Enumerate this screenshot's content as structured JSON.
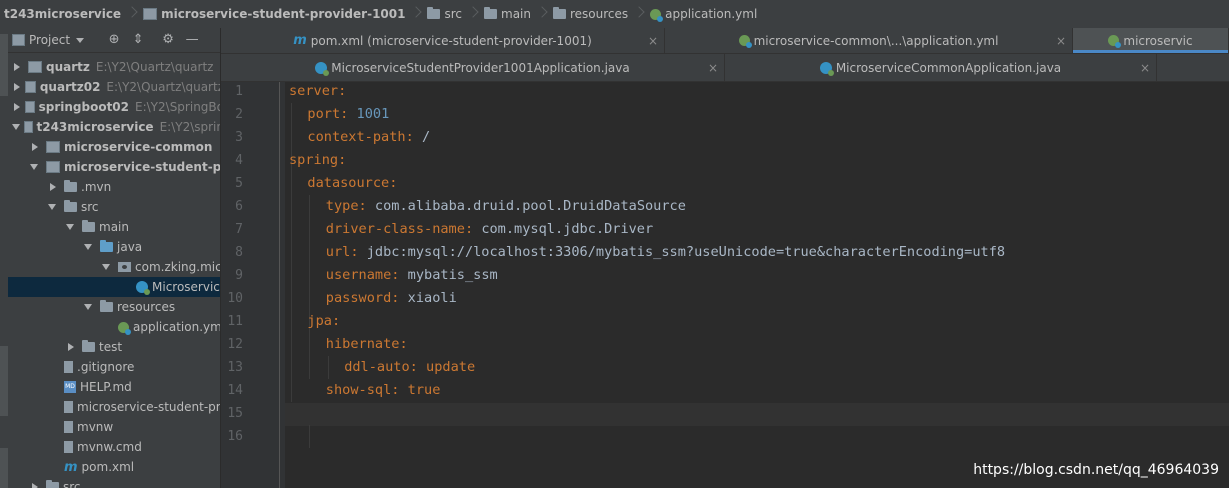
{
  "breadcrumb": [
    "t243microservice",
    "microservice-student-provider-1001",
    "src",
    "main",
    "resources",
    "application.yml"
  ],
  "project_panel": {
    "title": "Project"
  },
  "tree": [
    {
      "label": "quartz",
      "path": "E:\\Y2\\Quartz\\quartz",
      "indent": 0,
      "arrow": "right",
      "icon": "module",
      "bold": true
    },
    {
      "label": "quartz02",
      "path": "E:\\Y2\\Quartz\\quartz",
      "indent": 0,
      "arrow": "right",
      "icon": "module",
      "bold": true
    },
    {
      "label": "springboot02",
      "path": "E:\\Y2\\SpringBo",
      "indent": 0,
      "arrow": "right",
      "icon": "module",
      "bold": true
    },
    {
      "label": "t243microservice",
      "path": "E:\\Y2\\sprin",
      "indent": 0,
      "arrow": "down",
      "icon": "module",
      "bold": true
    },
    {
      "label": "microservice-common",
      "path": "",
      "indent": 1,
      "arrow": "right",
      "icon": "module",
      "bold": true
    },
    {
      "label": "microservice-student-pro",
      "path": "",
      "indent": 1,
      "arrow": "down",
      "icon": "module",
      "bold": true
    },
    {
      "label": ".mvn",
      "path": "",
      "indent": 2,
      "arrow": "right",
      "icon": "folder",
      "bold": false
    },
    {
      "label": "src",
      "path": "",
      "indent": 2,
      "arrow": "down",
      "icon": "folder",
      "bold": false
    },
    {
      "label": "main",
      "path": "",
      "indent": 3,
      "arrow": "down",
      "icon": "folder",
      "bold": false
    },
    {
      "label": "java",
      "path": "",
      "indent": 4,
      "arrow": "down",
      "icon": "folder-blue",
      "bold": false
    },
    {
      "label": "com.zking.mic",
      "path": "",
      "indent": 5,
      "arrow": "down",
      "icon": "package",
      "bold": false
    },
    {
      "label": "Microservic",
      "path": "",
      "indent": 6,
      "arrow": "none",
      "icon": "class",
      "bold": false,
      "selected": true
    },
    {
      "label": "resources",
      "path": "",
      "indent": 4,
      "arrow": "down",
      "icon": "folder",
      "bold": false
    },
    {
      "label": "application.ym",
      "path": "",
      "indent": 5,
      "arrow": "none",
      "icon": "spring",
      "bold": false
    },
    {
      "label": "test",
      "path": "",
      "indent": 3,
      "arrow": "right",
      "icon": "folder",
      "bold": false
    },
    {
      "label": ".gitignore",
      "path": "",
      "indent": 2,
      "arrow": "none",
      "icon": "file",
      "bold": false
    },
    {
      "label": "HELP.md",
      "path": "",
      "indent": 2,
      "arrow": "none",
      "icon": "md",
      "bold": false
    },
    {
      "label": "microservice-student-pr",
      "path": "",
      "indent": 2,
      "arrow": "none",
      "icon": "file",
      "bold": false
    },
    {
      "label": "mvnw",
      "path": "",
      "indent": 2,
      "arrow": "none",
      "icon": "file",
      "bold": false
    },
    {
      "label": "mvnw.cmd",
      "path": "",
      "indent": 2,
      "arrow": "none",
      "icon": "file",
      "bold": false
    },
    {
      "label": "pom.xml",
      "path": "",
      "indent": 2,
      "arrow": "none",
      "icon": "m",
      "bold": false
    },
    {
      "label": "src",
      "path": "",
      "indent": 1,
      "arrow": "right",
      "icon": "folder",
      "bold": false
    }
  ],
  "tabs_row1": [
    {
      "label": "pom.xml (microservice-student-provider-1001)",
      "icon": "m",
      "close": "×"
    },
    {
      "label": "microservice-common\\...\\application.yml",
      "icon": "spring",
      "close": "×"
    },
    {
      "label": "microservic",
      "icon": "spring",
      "close": "",
      "active": true
    }
  ],
  "tabs_row2": [
    {
      "label": "MicroserviceStudentProvider1001Application.java",
      "icon": "class",
      "close": "×"
    },
    {
      "label": "MicroserviceCommonApplication.java",
      "icon": "class",
      "close": "×"
    }
  ],
  "code": [
    {
      "n": "1",
      "indent": 0,
      "key": "server",
      "sep": ":",
      "val": "",
      "vtype": ""
    },
    {
      "n": "2",
      "indent": 1,
      "key": "port",
      "sep": ": ",
      "val": "1001",
      "vtype": "num"
    },
    {
      "n": "3",
      "indent": 1,
      "key": "context-path",
      "sep": ": ",
      "val": "/",
      "vtype": "str"
    },
    {
      "n": "4",
      "indent": 0,
      "key": "spring",
      "sep": ":",
      "val": "",
      "vtype": ""
    },
    {
      "n": "5",
      "indent": 1,
      "key": "datasource",
      "sep": ":",
      "val": "",
      "vtype": ""
    },
    {
      "n": "6",
      "indent": 2,
      "key": "type",
      "sep": ": ",
      "val": "com.alibaba.druid.pool.DruidDataSource",
      "vtype": "str"
    },
    {
      "n": "7",
      "indent": 2,
      "key": "driver-class-name",
      "sep": ": ",
      "val": "com.mysql.jdbc.Driver",
      "vtype": "str"
    },
    {
      "n": "8",
      "indent": 2,
      "key": "url",
      "sep": ": ",
      "val": "jdbc:mysql://localhost:3306/mybatis_ssm?useUnicode=true&characterEncoding=utf8",
      "vtype": "str"
    },
    {
      "n": "9",
      "indent": 2,
      "key": "username",
      "sep": ": ",
      "val": "mybatis_ssm",
      "vtype": "str"
    },
    {
      "n": "10",
      "indent": 2,
      "key": "password",
      "sep": ": ",
      "val": "xiaoli",
      "vtype": "str"
    },
    {
      "n": "11",
      "indent": 1,
      "key": "jpa",
      "sep": ":",
      "val": "",
      "vtype": ""
    },
    {
      "n": "12",
      "indent": 2,
      "key": "hibernate",
      "sep": ":",
      "val": "",
      "vtype": ""
    },
    {
      "n": "13",
      "indent": 3,
      "key": "ddl-auto",
      "sep": ": ",
      "val": "update",
      "vtype": "kw"
    },
    {
      "n": "14",
      "indent": 2,
      "key": "show-sql",
      "sep": ": ",
      "val": "true",
      "vtype": "kw"
    },
    {
      "n": "15",
      "indent": 0,
      "key": "",
      "sep": "",
      "val": "",
      "vtype": ""
    },
    {
      "n": "16",
      "indent": 0,
      "key": "",
      "sep": "",
      "val": "",
      "vtype": ""
    }
  ],
  "watermark": "https://blog.csdn.net/qq_46964039"
}
